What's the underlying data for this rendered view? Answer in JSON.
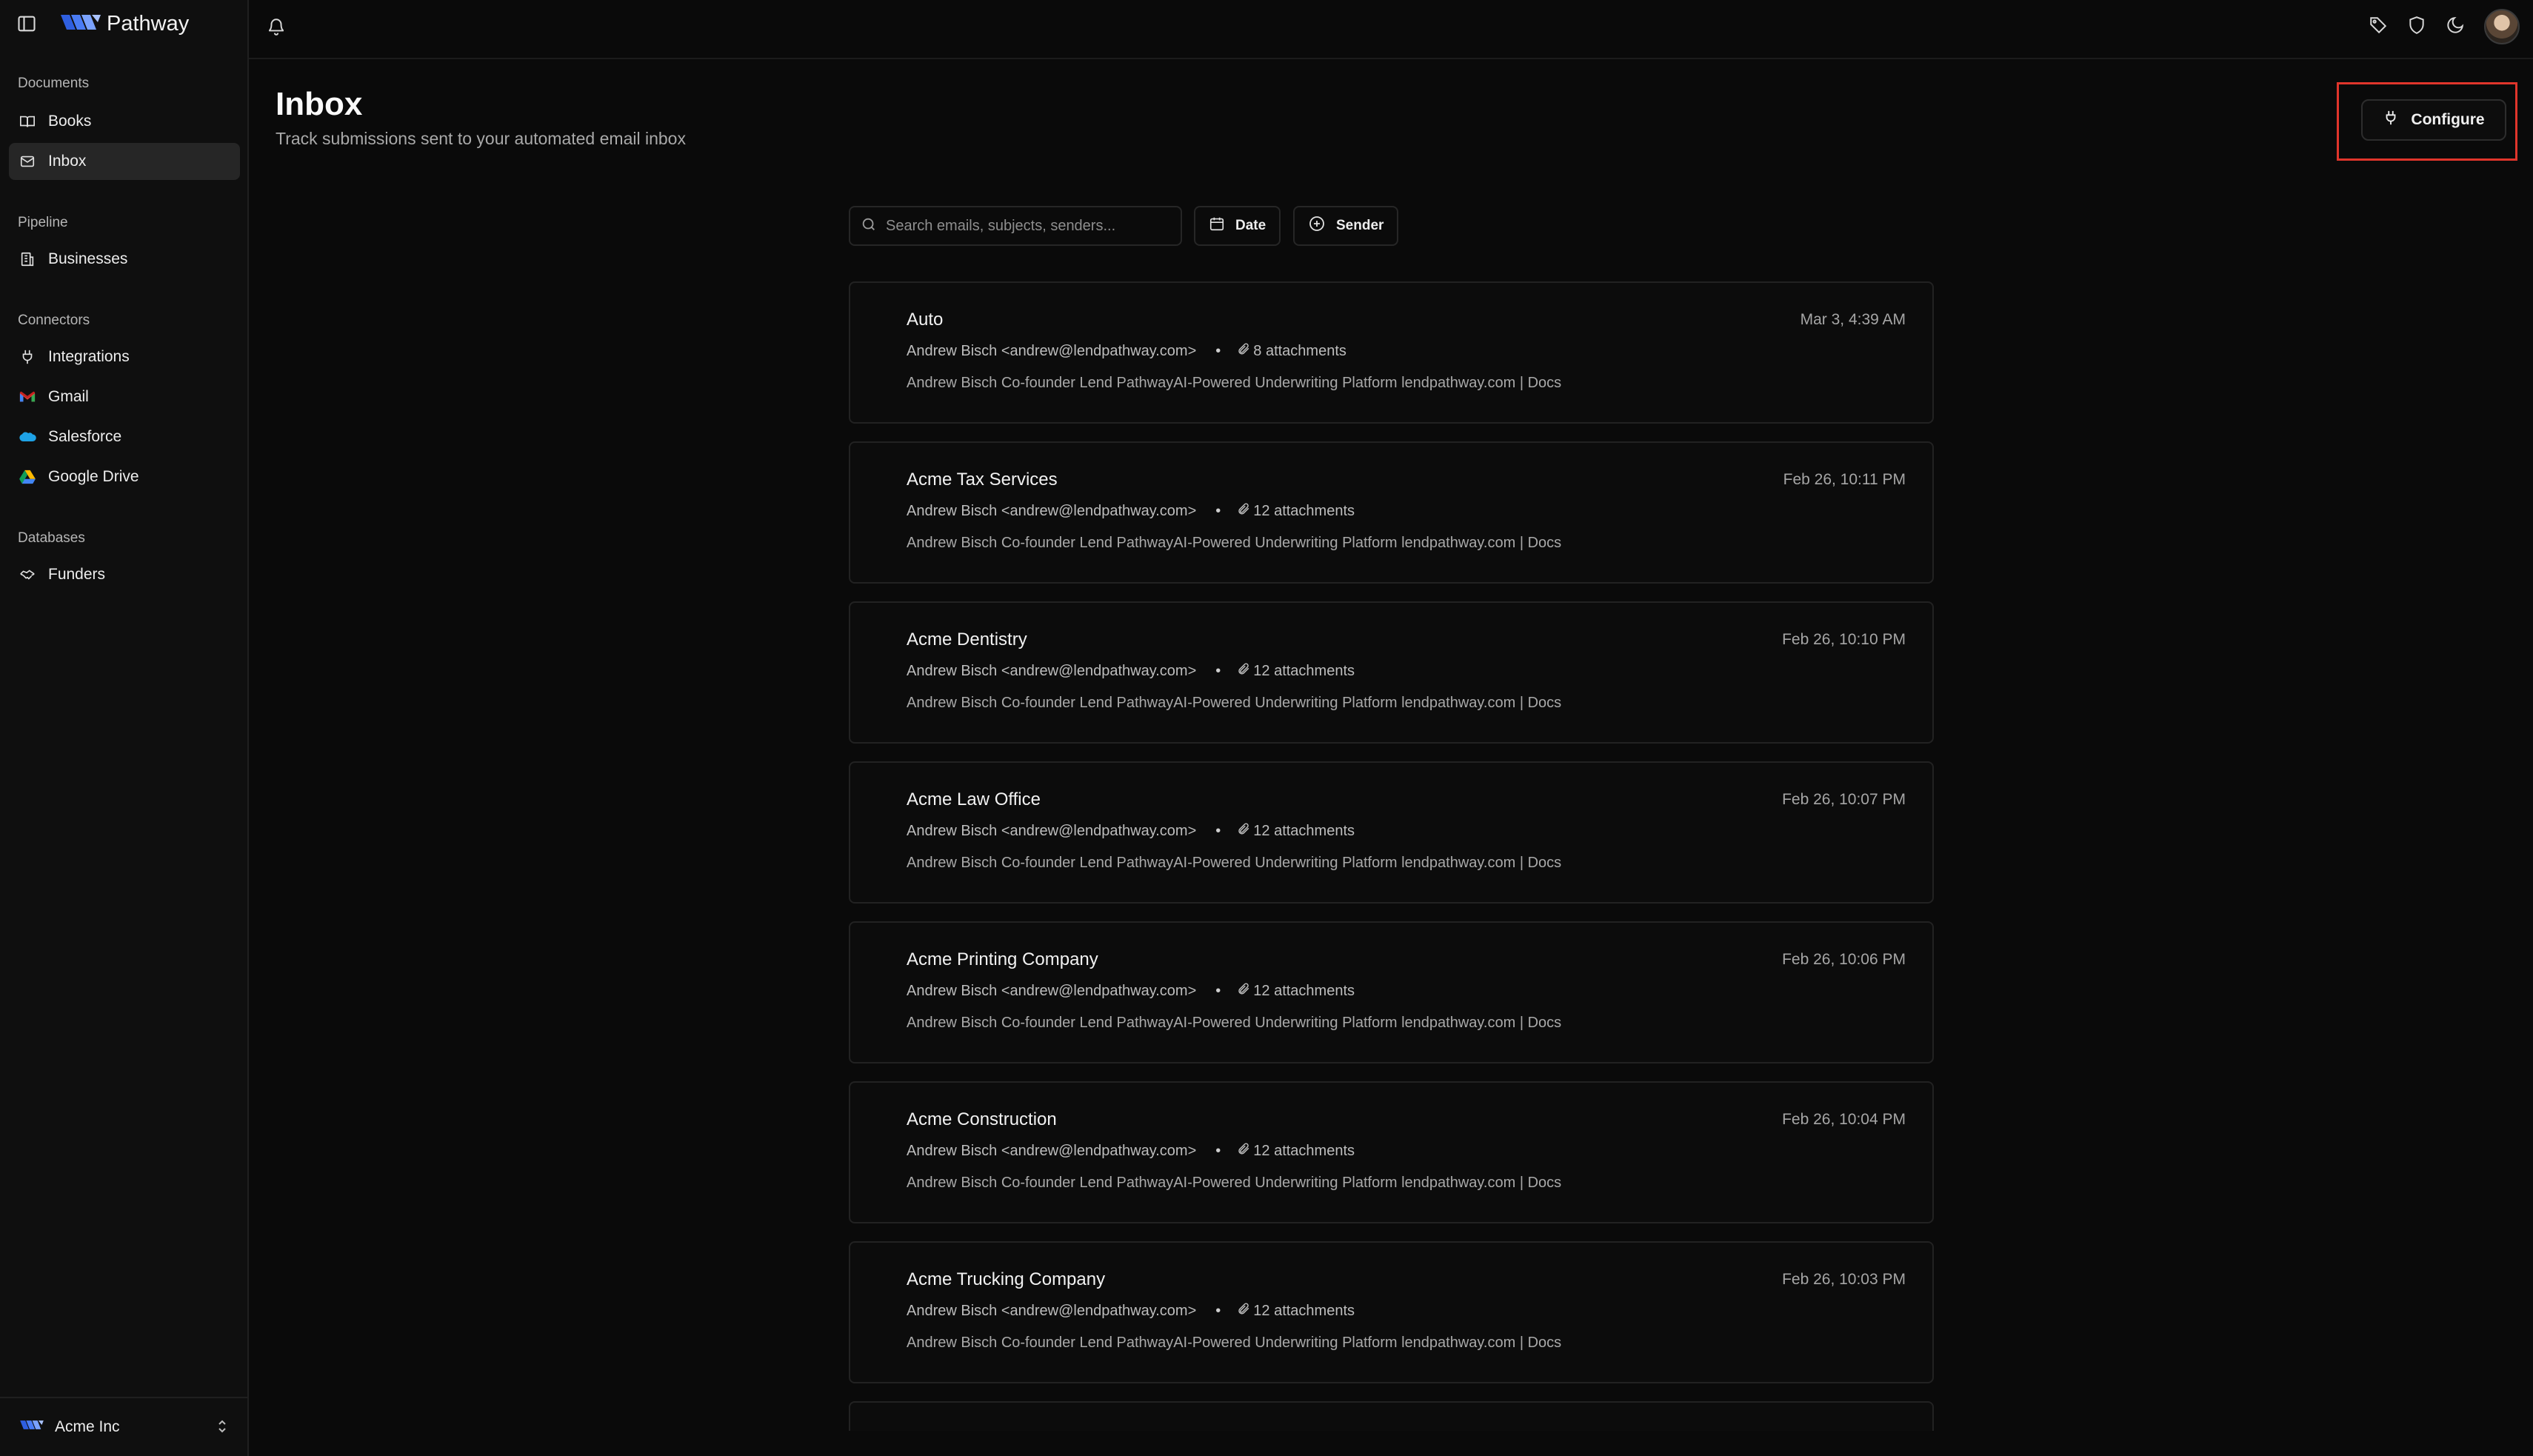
{
  "app": {
    "name": "Pathway",
    "org": "Acme Inc",
    "colors": {
      "brand": "#3a6df0",
      "highlight": "#e0352b",
      "background": "#0a0a0a"
    }
  },
  "sidebar": {
    "sections": [
      {
        "title": "Documents",
        "items": [
          {
            "label": "Books",
            "icon": "book-icon"
          },
          {
            "label": "Inbox",
            "icon": "mail-icon",
            "active": true
          }
        ]
      },
      {
        "title": "Pipeline",
        "items": [
          {
            "label": "Businesses",
            "icon": "building-icon"
          }
        ]
      },
      {
        "title": "Connectors",
        "items": [
          {
            "label": "Integrations",
            "icon": "plug-icon"
          },
          {
            "label": "Gmail",
            "icon": "gmail-icon"
          },
          {
            "label": "Salesforce",
            "icon": "salesforce-icon"
          },
          {
            "label": "Google Drive",
            "icon": "google-drive-icon"
          }
        ]
      },
      {
        "title": "Databases",
        "items": [
          {
            "label": "Funders",
            "icon": "handshake-icon"
          }
        ]
      }
    ]
  },
  "page": {
    "title": "Inbox",
    "subtitle": "Track submissions sent to your automated email inbox",
    "configure_label": "Configure"
  },
  "filters": {
    "search_placeholder": "Search emails, subjects, senders...",
    "date_label": "Date",
    "sender_label": "Sender"
  },
  "emails": [
    {
      "subject": "Auto",
      "date": "Mar 3, 4:39 AM",
      "sender": "Andrew Bisch <andrew@lendpathway.com>",
      "attachments": "8 attachments",
      "snippet": "Andrew Bisch Co-founder Lend PathwayAI-Powered Underwriting Platform lendpathway.com | Docs"
    },
    {
      "subject": "Acme Tax Services",
      "date": "Feb 26, 10:11 PM",
      "sender": "Andrew Bisch <andrew@lendpathway.com>",
      "attachments": "12 attachments",
      "snippet": "Andrew Bisch Co-founder Lend PathwayAI-Powered Underwriting Platform lendpathway.com | Docs"
    },
    {
      "subject": "Acme Dentistry",
      "date": "Feb 26, 10:10 PM",
      "sender": "Andrew Bisch <andrew@lendpathway.com>",
      "attachments": "12 attachments",
      "snippet": "Andrew Bisch Co-founder Lend PathwayAI-Powered Underwriting Platform lendpathway.com | Docs"
    },
    {
      "subject": "Acme Law Office",
      "date": "Feb 26, 10:07 PM",
      "sender": "Andrew Bisch <andrew@lendpathway.com>",
      "attachments": "12 attachments",
      "snippet": "Andrew Bisch Co-founder Lend PathwayAI-Powered Underwriting Platform lendpathway.com | Docs"
    },
    {
      "subject": "Acme Printing Company",
      "date": "Feb 26, 10:06 PM",
      "sender": "Andrew Bisch <andrew@lendpathway.com>",
      "attachments": "12 attachments",
      "snippet": "Andrew Bisch Co-founder Lend PathwayAI-Powered Underwriting Platform lendpathway.com | Docs"
    },
    {
      "subject": "Acme Construction",
      "date": "Feb 26, 10:04 PM",
      "sender": "Andrew Bisch <andrew@lendpathway.com>",
      "attachments": "12 attachments",
      "snippet": "Andrew Bisch Co-founder Lend PathwayAI-Powered Underwriting Platform lendpathway.com | Docs"
    },
    {
      "subject": "Acme Trucking Company",
      "date": "Feb 26, 10:03 PM",
      "sender": "Andrew Bisch <andrew@lendpathway.com>",
      "attachments": "12 attachments",
      "snippet": "Andrew Bisch Co-founder Lend PathwayAI-Powered Underwriting Platform lendpathway.com | Docs"
    }
  ]
}
